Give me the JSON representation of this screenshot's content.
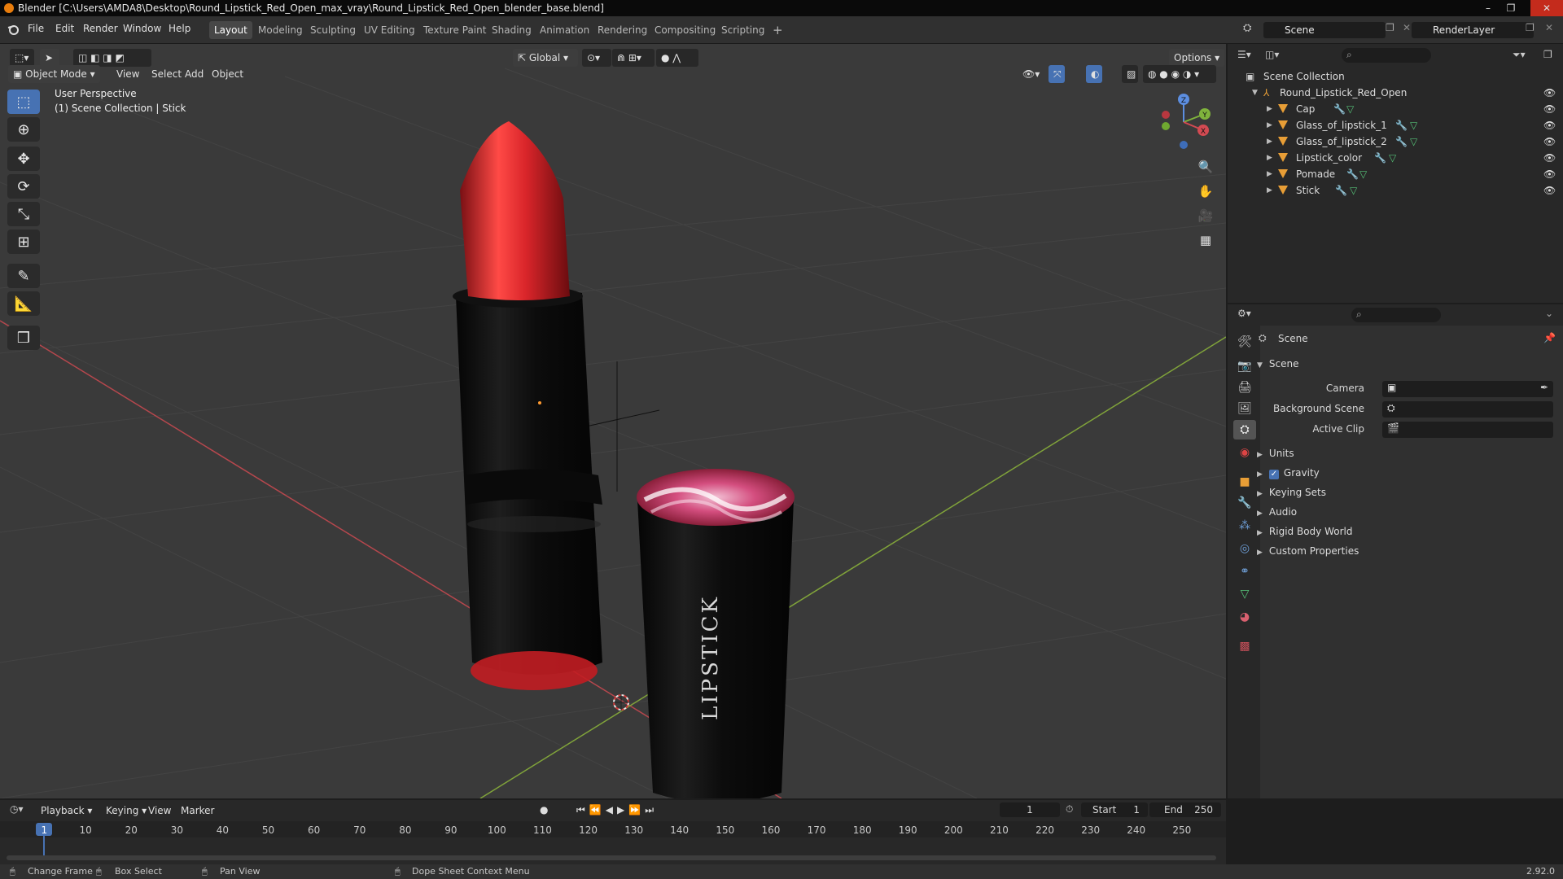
{
  "window": {
    "title": "Blender [C:\\Users\\AMDA8\\Desktop\\Round_Lipstick_Red_Open_max_vray\\Round_Lipstick_Red_Open_blender_base.blend]",
    "controls": [
      "–",
      "❐",
      "✕"
    ]
  },
  "menubar": {
    "items": [
      "File",
      "Edit",
      "Render",
      "Window",
      "Help"
    ]
  },
  "workspaces": {
    "tabs": [
      "Layout",
      "Modeling",
      "Sculpting",
      "UV Editing",
      "Texture Paint",
      "Shading",
      "Animation",
      "Rendering",
      "Compositing",
      "Scripting"
    ],
    "active": "Layout",
    "add": "+"
  },
  "scene_selector": {
    "value": "Scene"
  },
  "view_layer_selector": {
    "value": "RenderLayer"
  },
  "viewport": {
    "mode": "Object Mode",
    "menus": [
      "View",
      "Select",
      "Add",
      "Object"
    ],
    "transform_orientation": "Global",
    "options_label": "Options",
    "overlay_text": {
      "perspective": "User Perspective",
      "collection": "(1) Scene Collection | Stick"
    },
    "gizmo_axes": {
      "z": "Z",
      "y": "Y",
      "x": "X"
    },
    "cap_label": "LIPSTICK",
    "colors": {
      "background": "#3a3a3a",
      "lipstick_red": "#d9252a",
      "case_black": "#0e0e0e",
      "axis_x": "#b5474d",
      "axis_y": "#80a33a"
    }
  },
  "toolbar": {
    "tools": [
      "select-box-icon",
      "cursor-icon",
      "move-icon",
      "rotate-icon",
      "scale-icon",
      "transform-icon",
      "annotate-icon",
      "measure-icon",
      "add-cube-icon"
    ]
  },
  "outliner": {
    "root": "Scene Collection",
    "collection": "Round_Lipstick_Red_Open",
    "objects": [
      "Cap",
      "Glass_of_lipstick_1",
      "Glass_of_lipstick_2",
      "Lipstick_color",
      "Pomade",
      "Stick"
    ]
  },
  "properties": {
    "context": "Scene",
    "panel": "Scene",
    "fields": {
      "camera": "Camera",
      "background_scene": "Background Scene",
      "active_clip": "Active Clip"
    },
    "sections": [
      "Units",
      "Gravity",
      "Keying Sets",
      "Audio",
      "Rigid Body World",
      "Custom Properties"
    ],
    "gravity_checked": true
  },
  "timeline": {
    "menus": [
      "Playback",
      "Keying",
      "View",
      "Marker"
    ],
    "current_frame": "1",
    "start_label": "Start",
    "start_value": "1",
    "end_label": "End",
    "end_value": "250",
    "ruler": [
      "1",
      "10",
      "20",
      "30",
      "40",
      "50",
      "60",
      "70",
      "80",
      "90",
      "100",
      "110",
      "120",
      "130",
      "140",
      "150",
      "160",
      "170",
      "180",
      "190",
      "200",
      "210",
      "220",
      "230",
      "240",
      "250"
    ]
  },
  "statusbar": {
    "change_frame": "Change Frame",
    "box_select": "Box Select",
    "pan_view": "Pan View",
    "context_menu": "Dope Sheet Context Menu",
    "version": "2.92.0"
  }
}
